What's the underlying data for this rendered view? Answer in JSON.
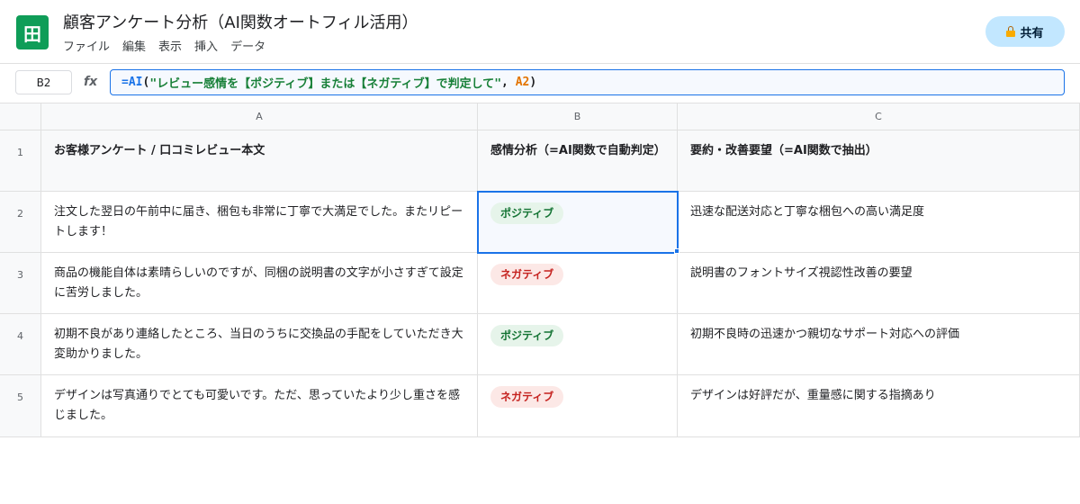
{
  "app": {
    "icon_glyph": "田",
    "doc_title": "顧客アンケート分析（AI関数オートフィル活用）",
    "menu": [
      "ファイル",
      "編集",
      "表示",
      "挿入",
      "データ"
    ],
    "share_label": "共有",
    "accent_color": "#0f9d58"
  },
  "formula_bar": {
    "cell_ref": "B2",
    "fx_label": "fx",
    "parts": {
      "func": "=AI",
      "open": "(",
      "string": "\"レビュー感情を【ポジティブ】または【ネガティブ】で判定して\"",
      "comma": ", ",
      "ref": "A2",
      "close": ")"
    }
  },
  "sheet": {
    "columns": [
      "A",
      "B",
      "C"
    ],
    "header_row": {
      "row_num": "1",
      "a": "お客様アンケート / 口コミレビュー本文",
      "b": "感情分析（=AI関数で自動判定）",
      "c": "要約・改善要望（=AI関数で抽出）"
    },
    "rows": [
      {
        "row_num": "2",
        "review": "注文した翌日の午前中に届き、梱包も非常に丁寧で大満足でした。またリピートします！",
        "sentiment": "ポジティブ",
        "summary": "迅速な配送対応と丁寧な梱包への高い満足度"
      },
      {
        "row_num": "3",
        "review": "商品の機能自体は素晴らしいのですが、同梱の説明書の文字が小さすぎて設定に苦労しました。",
        "sentiment": "ネガティブ",
        "summary": "説明書のフォントサイズ視認性改善の要望"
      },
      {
        "row_num": "4",
        "review": "初期不良があり連絡したところ、当日のうちに交換品の手配をしていただき大変助かりました。",
        "sentiment": "ポジティブ",
        "summary": "初期不良時の迅速かつ親切なサポート対応への評価"
      },
      {
        "row_num": "5",
        "review": "デザインは写真通りでとても可愛いです。ただ、思っていたより少し重さを感じました。",
        "sentiment": "ネガティブ",
        "summary": "デザインは好評だが、重量感に関する指摘あり"
      }
    ]
  }
}
